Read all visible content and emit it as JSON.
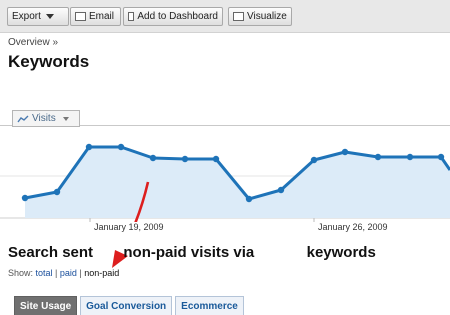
{
  "toolbar": {
    "export_label": "Export",
    "email_label": "Email",
    "dashboard_label": "Add to Dashboard",
    "visualize_label": "Visualize"
  },
  "breadcrumb": "Overview »",
  "page_title": "Keywords",
  "graph": {
    "metric_label": "Visits",
    "date_labels": [
      "January 19, 2009",
      "January 26, 2009"
    ],
    "line_color": "#1e73b8",
    "fill_color": "#dcebf8"
  },
  "section": {
    "title_part1": "Search sent",
    "title_part2": "non-paid visits via",
    "title_part3": "keywords"
  },
  "show": {
    "label": "Show:",
    "options": [
      "total",
      "paid",
      "non-paid"
    ],
    "selected": "non-paid"
  },
  "tabs": [
    "Site Usage",
    "Goal Conversion",
    "Ecommerce"
  ],
  "active_tab": "Site Usage",
  "annotation": {
    "color": "#dd1e1e"
  }
}
